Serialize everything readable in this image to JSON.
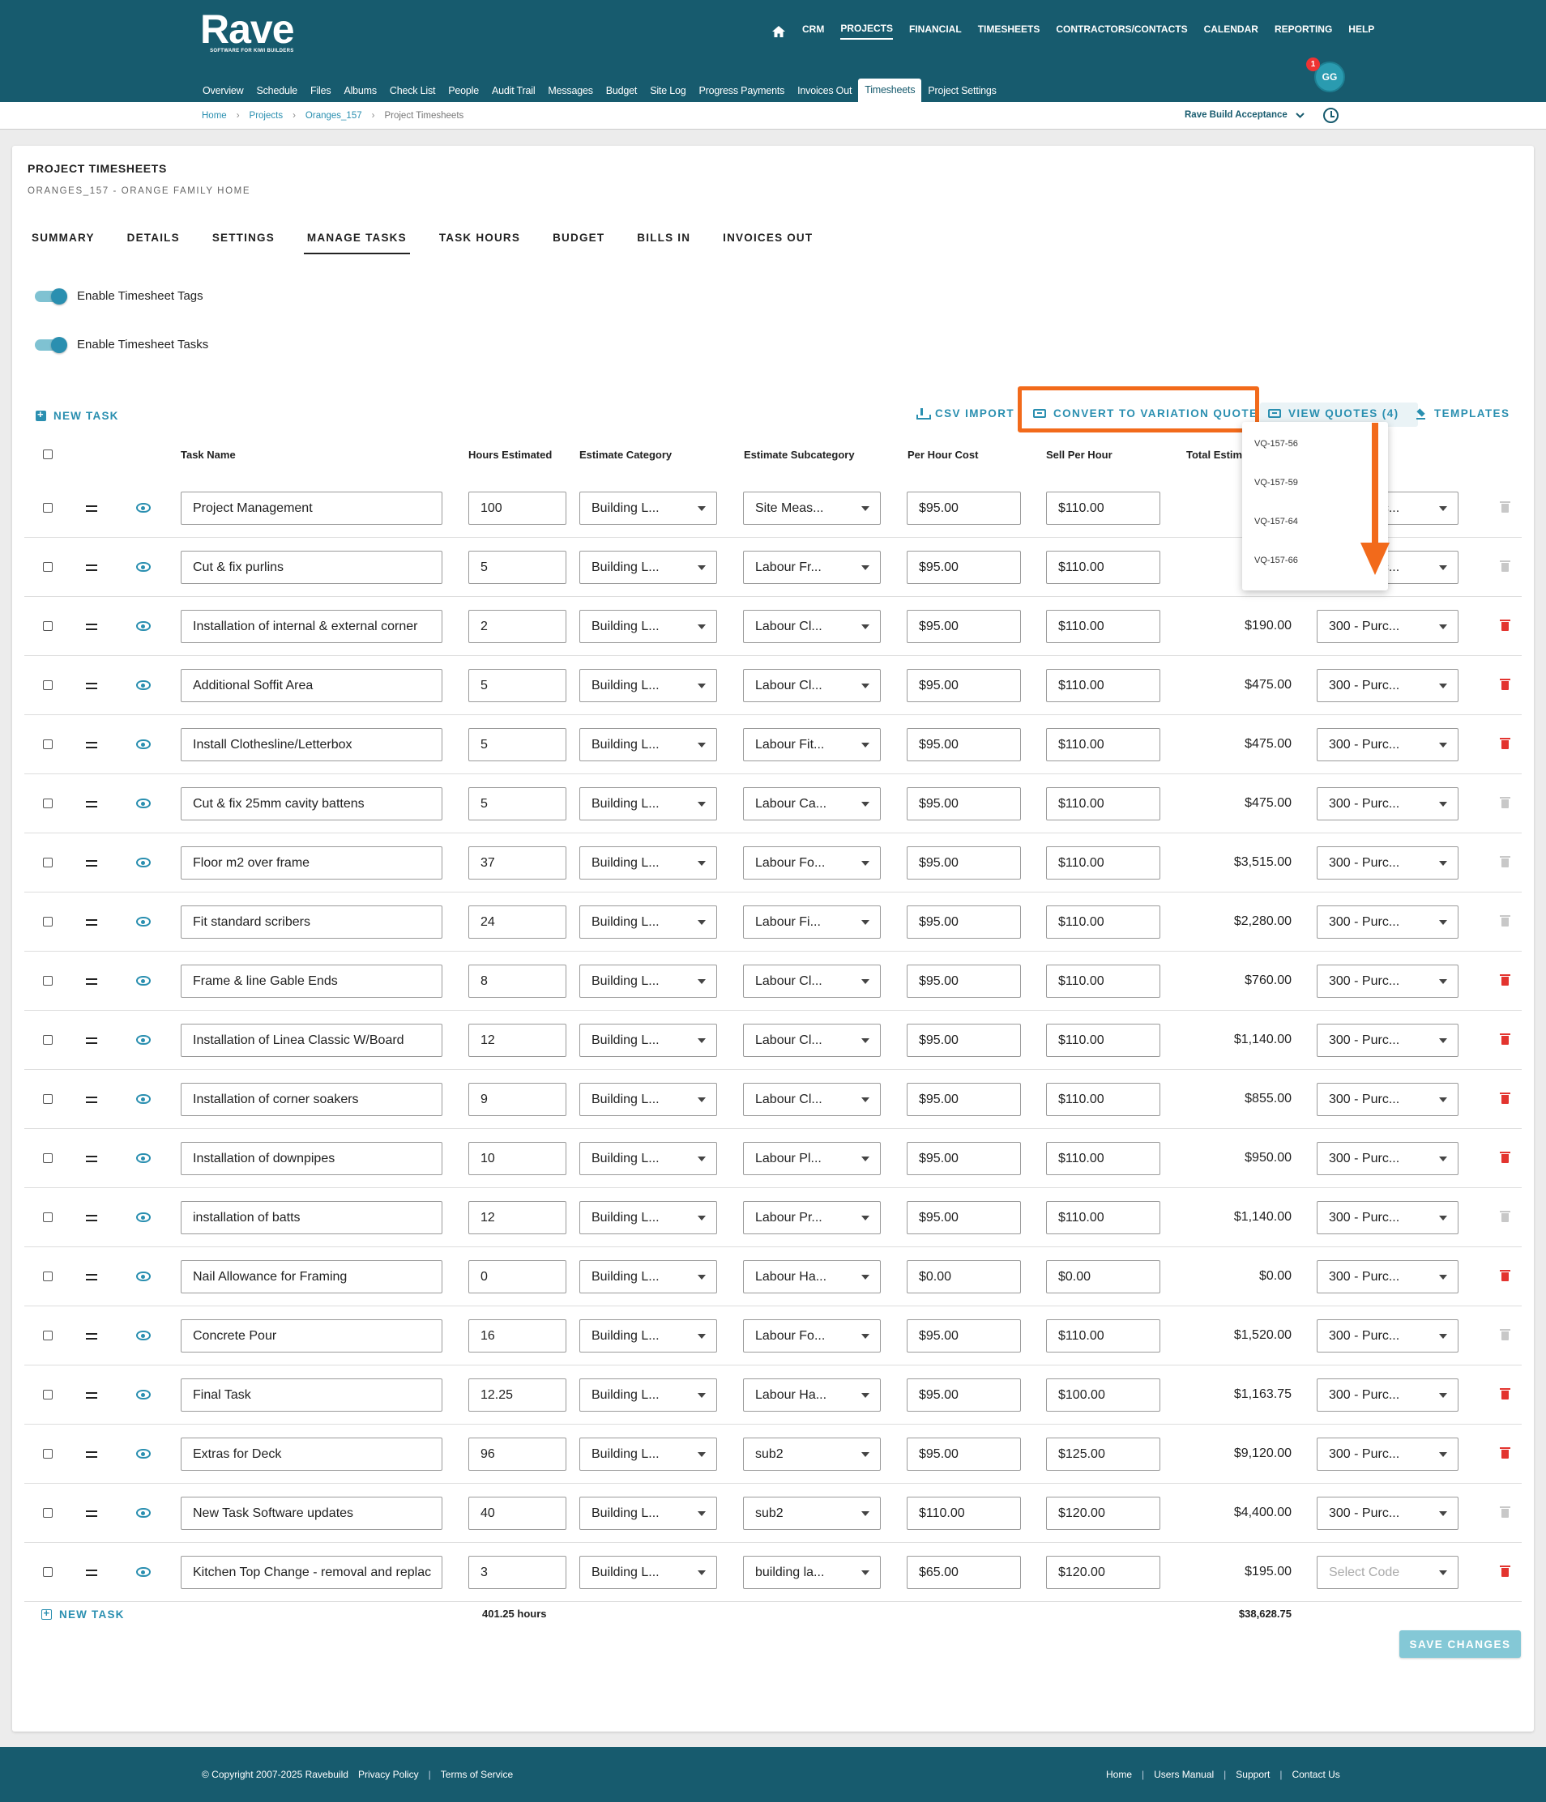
{
  "header": {
    "logo_text": "Rave",
    "logo_tagline": "SOFTWARE FOR KIWI BUILDERS",
    "main_nav": [
      "CRM",
      "PROJECTS",
      "FINANCIAL",
      "TIMESHEETS",
      "CONTRACTORS/CONTACTS",
      "CALENDAR",
      "REPORTING",
      "HELP"
    ],
    "main_nav_active": "PROJECTS",
    "sub_nav": [
      "Overview",
      "Schedule",
      "Files",
      "Albums",
      "Check List",
      "People",
      "Audit Trail",
      "Messages",
      "Budget",
      "Site Log",
      "Progress Payments",
      "Invoices Out",
      "Timesheets",
      "Project Settings"
    ],
    "sub_nav_active": "Timesheets",
    "avatar_initials": "GG",
    "notification_count": "1"
  },
  "breadcrumb": {
    "items": [
      "Home",
      "Projects",
      "Oranges_157"
    ],
    "current": "Project Timesheets",
    "company": "Rave Build Acceptance"
  },
  "page": {
    "title": "PROJECT TIMESHEETS",
    "subtitle": "ORANGES_157 - ORANGE FAMILY HOME",
    "tabs": [
      "SUMMARY",
      "DETAILS",
      "SETTINGS",
      "MANAGE TASKS",
      "TASK HOURS",
      "BUDGET",
      "BILLS IN",
      "INVOICES OUT"
    ],
    "active_tab": "MANAGE TASKS",
    "toggles": [
      {
        "label": "Enable Timesheet Tags",
        "on": true
      },
      {
        "label": "Enable Timesheet Tasks",
        "on": true
      }
    ]
  },
  "actions": {
    "new_task": "NEW TASK",
    "csv_import": "CSV IMPORT",
    "convert": "CONVERT TO VARIATION QUOTE",
    "view_quotes": "VIEW QUOTES (4)",
    "templates": "TEMPLATES"
  },
  "quotes_dropdown": [
    "VQ-157-56",
    "VQ-157-59",
    "VQ-157-64",
    "VQ-157-66"
  ],
  "table": {
    "headers": {
      "task_name": "Task Name",
      "hours": "Hours Estimated",
      "category": "Estimate Category",
      "subcategory": "Estimate Subcategory",
      "cost": "Per Hour Cost",
      "sell": "Sell Per Hour",
      "total": "Total Estim"
    },
    "rows": [
      {
        "name": "Project Management",
        "hours": "100",
        "cat": "Building L...",
        "sub": "Site Meas...",
        "cost": "$95.00",
        "sell": "$110.00",
        "total": "$9",
        "code": "300 - Purc...",
        "trash": "grey"
      },
      {
        "name": "Cut & fix purlins",
        "hours": "5",
        "cat": "Building L...",
        "sub": "Labour Fr...",
        "cost": "$95.00",
        "sell": "$110.00",
        "total": "",
        "code": "300 - Purc...",
        "trash": "grey"
      },
      {
        "name": "Installation of internal & external corner",
        "hours": "2",
        "cat": "Building L...",
        "sub": "Labour Cl...",
        "cost": "$95.00",
        "sell": "$110.00",
        "total": "$190.00",
        "code": "300 - Purc...",
        "trash": "red"
      },
      {
        "name": "Additional Soffit Area",
        "hours": "5",
        "cat": "Building L...",
        "sub": "Labour Cl...",
        "cost": "$95.00",
        "sell": "$110.00",
        "total": "$475.00",
        "code": "300 - Purc...",
        "trash": "red"
      },
      {
        "name": "Install Clothesline/Letterbox",
        "hours": "5",
        "cat": "Building L...",
        "sub": "Labour Fit...",
        "cost": "$95.00",
        "sell": "$110.00",
        "total": "$475.00",
        "code": "300 - Purc...",
        "trash": "red"
      },
      {
        "name": "Cut & fix 25mm cavity battens",
        "hours": "5",
        "cat": "Building L...",
        "sub": "Labour Ca...",
        "cost": "$95.00",
        "sell": "$110.00",
        "total": "$475.00",
        "code": "300 - Purc...",
        "trash": "grey"
      },
      {
        "name": "Floor m2 over frame",
        "hours": "37",
        "cat": "Building L...",
        "sub": "Labour Fo...",
        "cost": "$95.00",
        "sell": "$110.00",
        "total": "$3,515.00",
        "code": "300 - Purc...",
        "trash": "grey"
      },
      {
        "name": "Fit standard scribers",
        "hours": "24",
        "cat": "Building L...",
        "sub": "Labour Fi...",
        "cost": "$95.00",
        "sell": "$110.00",
        "total": "$2,280.00",
        "code": "300 - Purc...",
        "trash": "grey"
      },
      {
        "name": "Frame & line Gable Ends",
        "hours": "8",
        "cat": "Building L...",
        "sub": "Labour Cl...",
        "cost": "$95.00",
        "sell": "$110.00",
        "total": "$760.00",
        "code": "300 - Purc...",
        "trash": "red"
      },
      {
        "name": "Installation of Linea Classic W/Board",
        "hours": "12",
        "cat": "Building L...",
        "sub": "Labour Cl...",
        "cost": "$95.00",
        "sell": "$110.00",
        "total": "$1,140.00",
        "code": "300 - Purc...",
        "trash": "red"
      },
      {
        "name": "Installation of corner soakers",
        "hours": "9",
        "cat": "Building L...",
        "sub": "Labour Cl...",
        "cost": "$95.00",
        "sell": "$110.00",
        "total": "$855.00",
        "code": "300 - Purc...",
        "trash": "red"
      },
      {
        "name": "Installation of downpipes",
        "hours": "10",
        "cat": "Building L...",
        "sub": "Labour Pl...",
        "cost": "$95.00",
        "sell": "$110.00",
        "total": "$950.00",
        "code": "300 - Purc...",
        "trash": "red"
      },
      {
        "name": "installation of batts",
        "hours": "12",
        "cat": "Building L...",
        "sub": "Labour Pr...",
        "cost": "$95.00",
        "sell": "$110.00",
        "total": "$1,140.00",
        "code": "300 - Purc...",
        "trash": "grey"
      },
      {
        "name": "Nail Allowance for Framing",
        "hours": "0",
        "cat": "Building L...",
        "sub": "Labour Ha...",
        "cost": "$0.00",
        "sell": "$0.00",
        "total": "$0.00",
        "code": "300 - Purc...",
        "trash": "red"
      },
      {
        "name": "Concrete Pour",
        "hours": "16",
        "cat": "Building L...",
        "sub": "Labour Fo...",
        "cost": "$95.00",
        "sell": "$110.00",
        "total": "$1,520.00",
        "code": "300 - Purc...",
        "trash": "grey"
      },
      {
        "name": "Final Task",
        "hours": "12.25",
        "cat": "Building L...",
        "sub": "Labour Ha...",
        "cost": "$95.00",
        "sell": "$100.00",
        "total": "$1,163.75",
        "code": "300 - Purc...",
        "trash": "red"
      },
      {
        "name": "Extras for Deck",
        "hours": "96",
        "cat": "Building L...",
        "sub": "sub2",
        "cost": "$95.00",
        "sell": "$125.00",
        "total": "$9,120.00",
        "code": "300 - Purc...",
        "trash": "red"
      },
      {
        "name": "New Task Software updates",
        "hours": "40",
        "cat": "Building L...",
        "sub": "sub2",
        "cost": "$110.00",
        "sell": "$120.00",
        "total": "$4,400.00",
        "code": "300 - Purc...",
        "trash": "grey"
      },
      {
        "name": "Kitchen Top Change - removal and replac",
        "hours": "3",
        "cat": "Building L...",
        "sub": "building la...",
        "cost": "$65.00",
        "sell": "$120.00",
        "total": "$195.00",
        "code": "",
        "code_placeholder": "Select Code",
        "trash": "red"
      }
    ],
    "total_hours": "401.25 hours",
    "total_estimate": "$38,628.75"
  },
  "save_button": "SAVE CHANGES",
  "footer": {
    "copyright": "© Copyright 2007-2025 Ravebuild",
    "left_links": [
      "Privacy Policy",
      "Terms of Service"
    ],
    "right_links": [
      "Home",
      "Users Manual",
      "Support",
      "Contact Us"
    ]
  },
  "colors": {
    "header_bg": "#175b6e",
    "accent": "#2a8fb0",
    "highlight": "#f26a1b",
    "delete_red": "#e3342f"
  }
}
